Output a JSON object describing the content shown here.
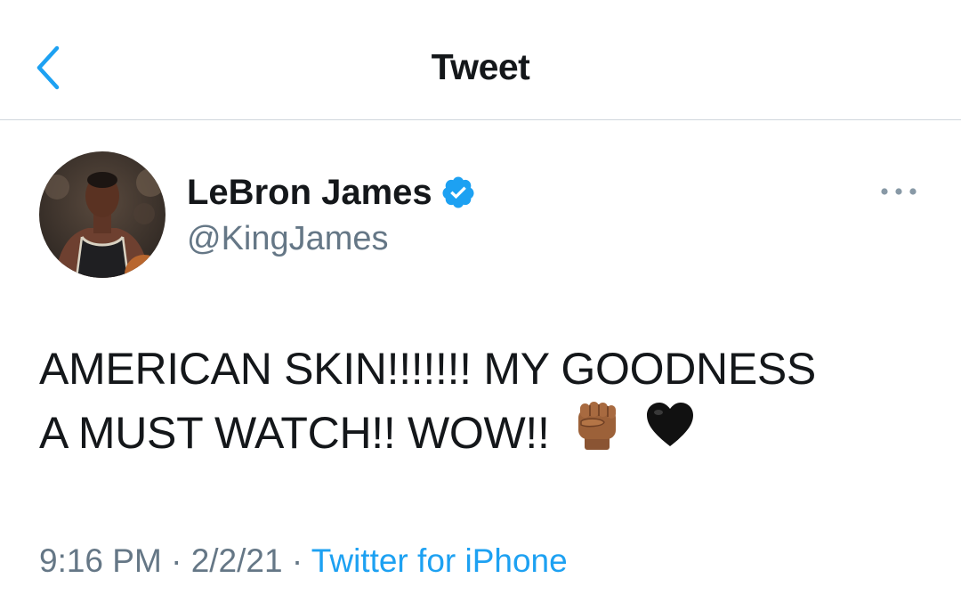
{
  "nav": {
    "title": "Tweet",
    "back_icon": "chevron-left-icon"
  },
  "tweet": {
    "author_name": "LeBron James",
    "author_handle": "@KingJames",
    "verified_icon": "verified-badge-icon",
    "more_icon": "more-horizontal-icon",
    "text_line_1": "AMERICAN SKIN!!!!!!! MY GOODNESS",
    "text_line_2": "A MUST WATCH!! WOW!!",
    "emojis": [
      "raised-fist-medium-dark-skin",
      "black-heart"
    ],
    "time": "9:16 PM",
    "separator": "·",
    "date": "2/2/21",
    "source": "Twitter for iPhone"
  },
  "colors": {
    "accent": "#1da1f2",
    "text_primary": "#14171a",
    "text_secondary": "#657786",
    "divider": "#cfd6dc"
  }
}
